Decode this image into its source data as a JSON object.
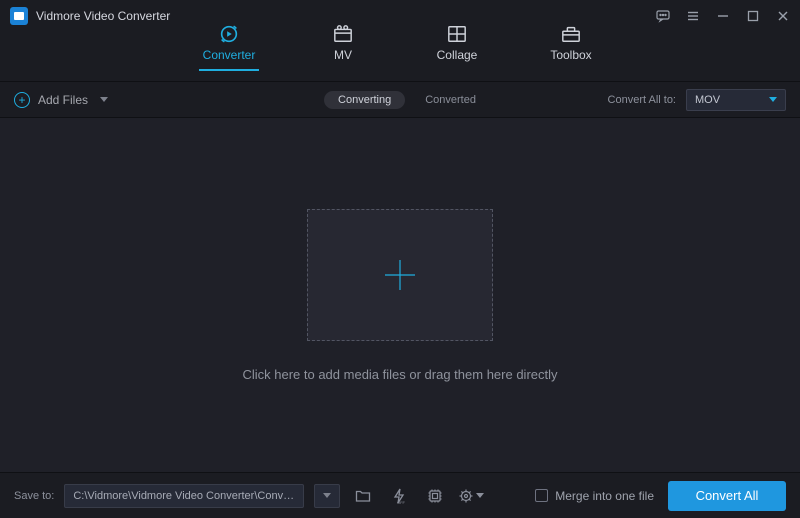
{
  "app": {
    "title": "Vidmore Video Converter"
  },
  "modes": {
    "converter": "Converter",
    "mv": "MV",
    "collage": "Collage",
    "toolbox": "Toolbox"
  },
  "strip": {
    "add_files": "Add Files",
    "converting": "Converting",
    "converted": "Converted",
    "convert_all_to": "Convert All to:",
    "format": "MOV"
  },
  "main": {
    "hint": "Click here to add media files or drag them here directly"
  },
  "bottom": {
    "save_to_label": "Save to:",
    "save_path": "C:\\Vidmore\\Vidmore Video Converter\\Converted",
    "merge": "Merge into one file",
    "convert_all": "Convert All"
  }
}
